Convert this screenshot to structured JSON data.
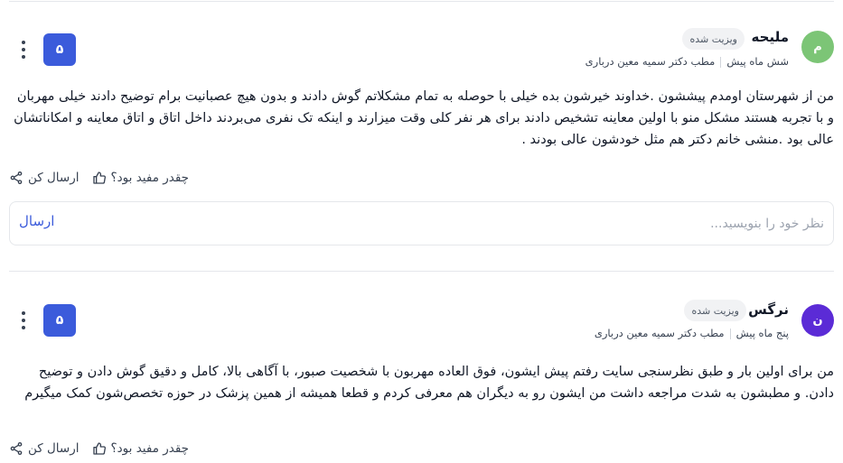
{
  "colors": {
    "accent": "#3b5bdb",
    "avatar_1": "#7cc576",
    "avatar_2": "#5b2bd6"
  },
  "reviews": [
    {
      "avatar_initial": "م",
      "name": "ملیحه",
      "badge": "ویزیت شده",
      "time": "شش ماه پیش",
      "office": "مطب دکتر سمیه معین درباری",
      "score": "۵",
      "text": "من از شهرستان اومدم پیششون .خداوند خیرشون بده خیلی با حوصله به تمام مشکلاتم گوش دادند و بدون هیچ عصبانیت برام توضیح دادند خیلی مهربان و با تجربه هستند مشکل منو با اولین معاینه تشخیص دادند برای هر نفر کلی وقت میزارند و اینکه تک نفری می‌بردند داخل اتاق و اتاق معاینه و امکاناتشان عالی بود .منشی خانم دکتر هم مثل خودشون عالی بودند .",
      "helpful_label": "چقدر مفید بود؟",
      "share_label": "ارسال کن",
      "helpful_icon": "thumbs-up-icon",
      "share_icon": "share-icon"
    },
    {
      "avatar_initial": "ن",
      "name": "نرگس",
      "badge": "ویزیت شده",
      "time": "پنج ماه پیش",
      "office": "مطب دکتر سمیه معین درباری",
      "score": "۵",
      "text": "من برای اولین بار و طبق نظرسنجی سایت رفتم پیش ایشون، فوق العاده مهربون با شخصیت صبور، با آگاهی بالا، کامل و دقیق گوش دادن و توضیح دادن. و مطبشون به شدت مراجعه داشت من ایشون رو به دیگران هم معرفی کردم و قطعا همیشه از همین پزشک در حوزه تخصص‌شون کمک میگیرم",
      "helpful_label": "چقدر مفید بود؟",
      "share_label": "ارسال کن",
      "helpful_icon": "thumbs-up-icon",
      "share_icon": "share-icon"
    }
  ],
  "comment": {
    "placeholder": "نظر خود را بنویسید...",
    "value": "",
    "submit_label": "ارسال"
  }
}
